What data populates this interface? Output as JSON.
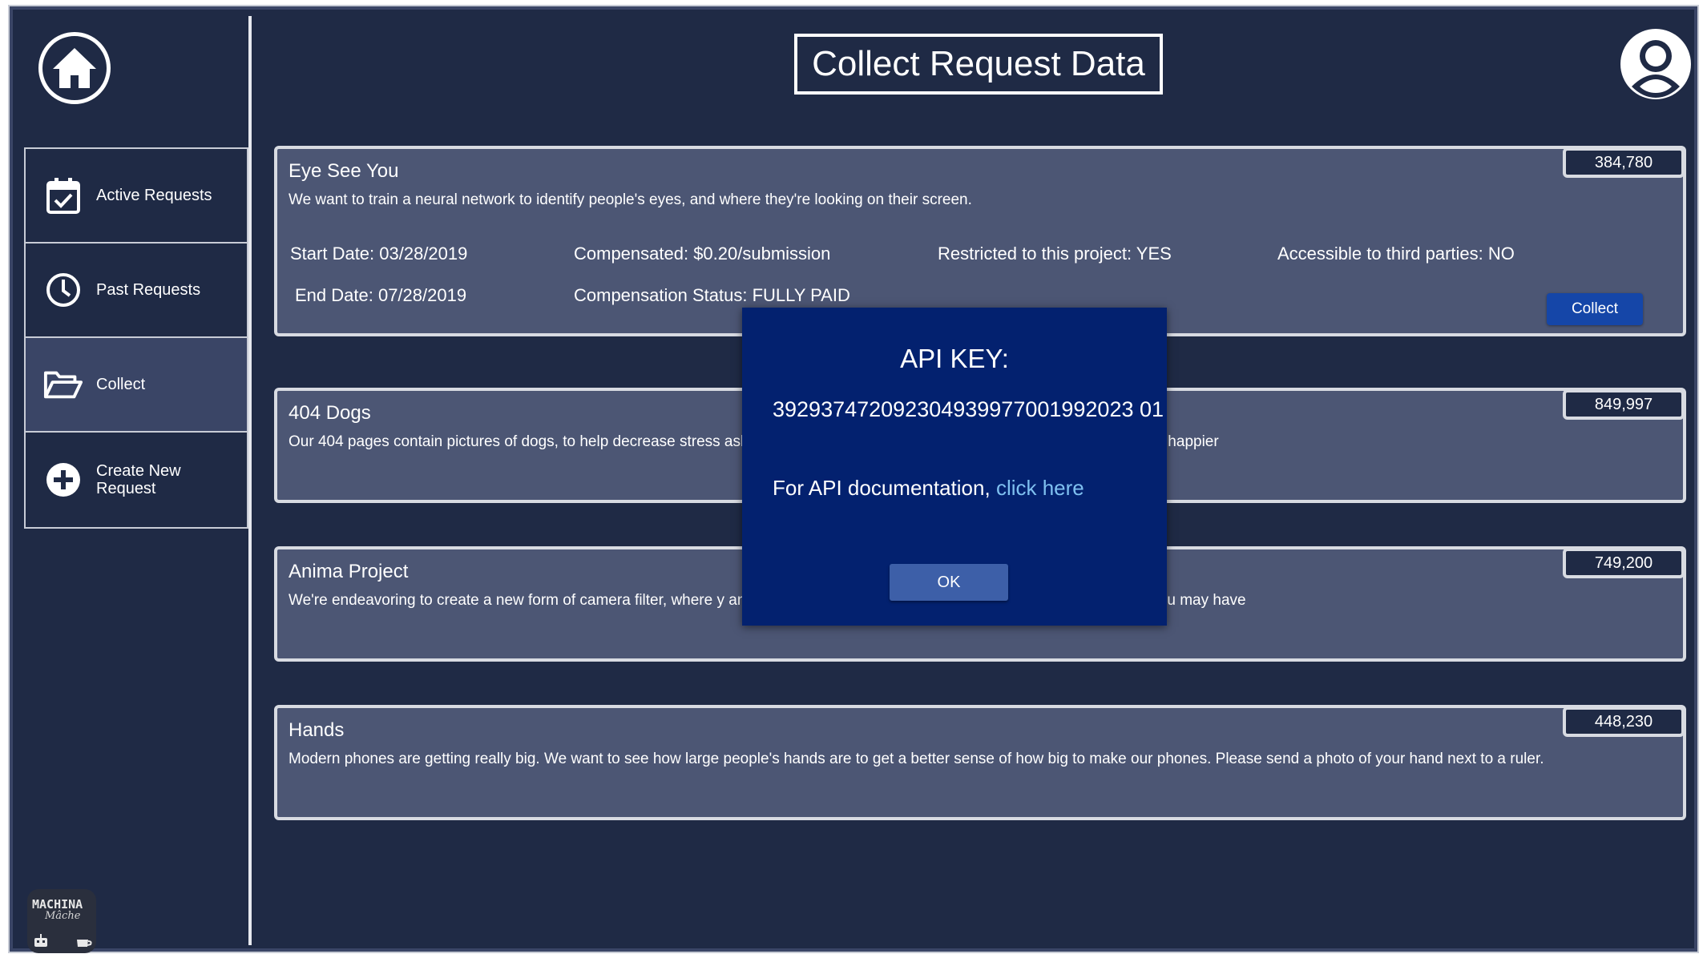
{
  "header": {
    "title": "Collect Request Data"
  },
  "sidebar": {
    "items": [
      {
        "label": "Active Requests",
        "icon": "calendar-check-icon"
      },
      {
        "label": "Past Requests",
        "icon": "clock-icon"
      },
      {
        "label": "Collect",
        "icon": "folder-open-icon",
        "active": true
      },
      {
        "label": "Create New\nRequest",
        "icon": "plus-circle-icon"
      }
    ],
    "brand": {
      "line1": "MACHINA",
      "line2": "Mâche"
    }
  },
  "requests": [
    {
      "title": "Eye See You",
      "count": "384,780",
      "description": "We want to train a neural network to identify people's eyes, and where they're looking on their screen.",
      "start_date": "Start Date: 03/28/2019",
      "end_date": "End Date: 07/28/2019",
      "compensated": "Compensated: $0.20/submission",
      "compensation_status": "Compensation Status: FULLY PAID",
      "restricted": "Restricted to this project: YES",
      "third_parties": "Accessible to third parties: NO",
      "collect_label": "Collect"
    },
    {
      "title": "404 Dogs",
      "count": "849,997",
      "description": "Our 404 pages contain pictures of dogs, to help decrease stress                                                         asking for more pictures of your furry friends to help make people happier"
    },
    {
      "title": "Anima Project",
      "count": "749,200",
      "description": "We're endeavoring to create a new form of camera filter, where y                                                         an image of your face and any head-on photos of animals that you may have"
    },
    {
      "title": "Hands",
      "count": "448,230",
      "description": "Modern phones are getting really big. We want to see how large people's hands are to get a better sense of how big to make our phones. Please send a photo of your hand next to a ruler."
    }
  ],
  "modal": {
    "title": "API KEY:",
    "api_key": "392937472092304939977001992023 01",
    "doc_prefix": "For API documentation, ",
    "doc_link": "click here",
    "ok_label": "OK"
  }
}
